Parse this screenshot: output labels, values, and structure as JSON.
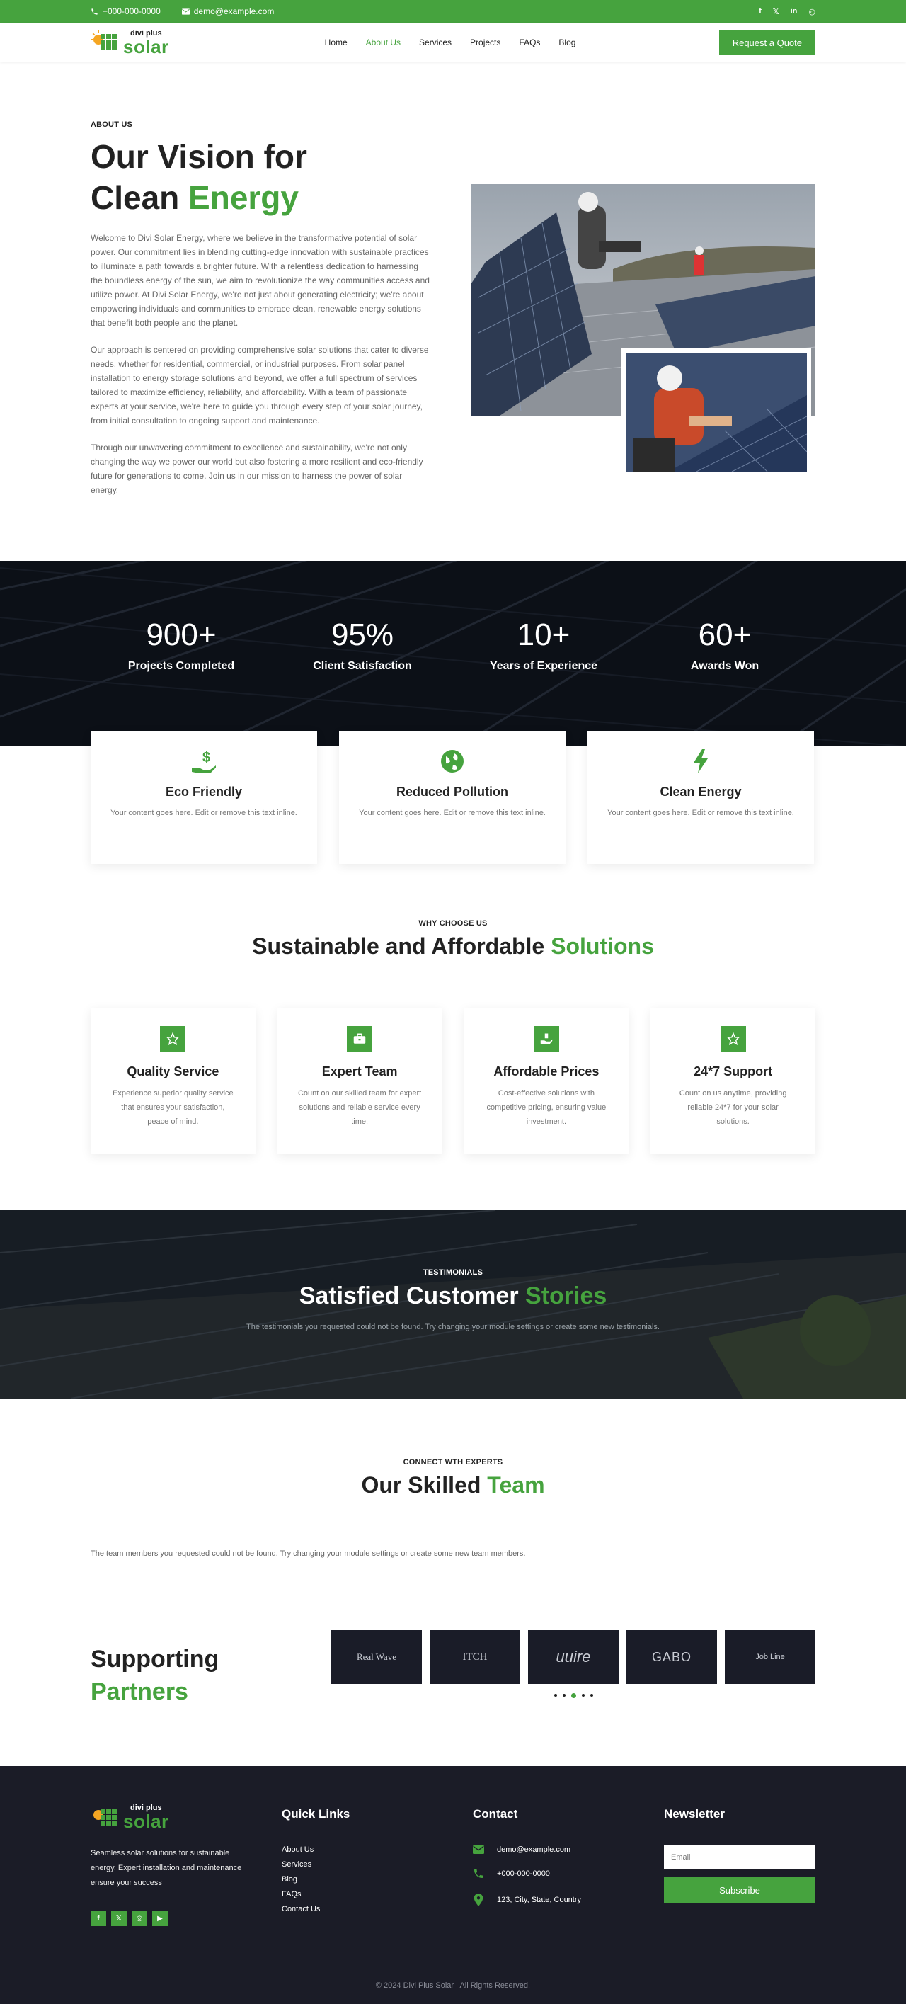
{
  "topbar": {
    "phone": "+000-000-0000",
    "email": "demo@example.com",
    "social": [
      "f",
      "𝕏",
      "in",
      "◎"
    ]
  },
  "header": {
    "logo_small": "divi plus",
    "logo_big": "solar",
    "nav": [
      {
        "label": "Home",
        "active": false
      },
      {
        "label": "About Us",
        "active": true
      },
      {
        "label": "Services",
        "active": false
      },
      {
        "label": "Projects",
        "active": false
      },
      {
        "label": "FAQs",
        "active": false
      },
      {
        "label": "Blog",
        "active": false
      }
    ],
    "cta": "Request a Quote"
  },
  "about": {
    "eyebrow": "ABOUT US",
    "title_line1": "Our Vision for",
    "title_line2_plain": "Clean ",
    "title_line2_accent": "Energy",
    "p1": "Welcome to Divi Solar Energy, where we believe in the transformative potential of solar power. Our commitment lies in blending cutting-edge innovation with sustainable practices to illuminate a path towards a brighter future. With a relentless dedication to harnessing the boundless energy of the sun, we aim to revolutionize the way communities access and utilize power. At Divi Solar Energy, we're not just about generating electricity; we're about empowering individuals and communities to embrace clean, renewable energy solutions that benefit both people and the planet.",
    "p2": "Our approach is centered on providing comprehensive solar solutions that cater to diverse needs, whether for residential, commercial, or industrial purposes. From solar panel installation to energy storage solutions and beyond, we offer a full spectrum of services tailored to maximize efficiency, reliability, and affordability. With a team of passionate experts at your service, we're here to guide you through every step of your solar journey, from initial consultation to ongoing support and maintenance.",
    "p3": "Through our unwavering commitment to excellence and sustainability, we're not only changing the way we power our world but also fostering a more resilient and eco-friendly future for generations to come. Join us in our mission to harness the power of solar energy."
  },
  "stats": [
    {
      "num": "900+",
      "label": "Projects Completed"
    },
    {
      "num": "95%",
      "label": "Client Satisfaction"
    },
    {
      "num": "10+",
      "label": "Years of Experience"
    },
    {
      "num": "60+",
      "label": "Awards Won"
    }
  ],
  "features": [
    {
      "icon": "hand-dollar-icon",
      "title": "Eco Friendly",
      "text": "Your content goes here. Edit or remove this text inline."
    },
    {
      "icon": "globe-icon",
      "title": "Reduced Pollution",
      "text": "Your content goes here. Edit or remove this text inline."
    },
    {
      "icon": "bolt-icon",
      "title": "Clean Energy",
      "text": "Your content goes here. Edit or remove this text inline."
    }
  ],
  "why": {
    "eyebrow": "WHY CHOOSE US",
    "title_plain": "Sustainable and Affordable ",
    "title_accent": "Solutions",
    "cards": [
      {
        "icon": "star-icon",
        "title": "Quality Service",
        "text": "Experience superior quality service that ensures your satisfaction, peace of mind."
      },
      {
        "icon": "briefcase-icon",
        "title": "Expert Team",
        "text": "Count on our skilled team for expert solutions and reliable service every time."
      },
      {
        "icon": "hand-money-icon",
        "title": "Affordable Prices",
        "text": "Cost-effective solutions with competitive pricing, ensuring value investment."
      },
      {
        "icon": "star-icon",
        "title": "24*7 Support",
        "text": "Count on us anytime, providing reliable 24*7 for your solar solutions."
      }
    ]
  },
  "testimonials": {
    "eyebrow": "TESTIMONIALS",
    "title_plain": "Satisfied Customer ",
    "title_accent": "Stories",
    "empty": "The testimonials you requested could not be found. Try changing your module settings or create some new testimonials."
  },
  "team": {
    "eyebrow": "CONNECT WTH EXPERTS",
    "title_plain": "Our Skilled ",
    "title_accent": "Team",
    "empty": "The team members you requested could not be found. Try changing your module settings or create some new team members."
  },
  "partners": {
    "title_plain": "Supporting",
    "title_accent": "Partners",
    "logos": [
      "Real Wave",
      "ITCH",
      "uuire",
      "GABO",
      "Job Line"
    ],
    "active_dot": 2
  },
  "footer": {
    "logo_small": "divi plus",
    "logo_big": "solar",
    "desc": "Seamless solar solutions for sustainable energy. Expert installation and maintenance ensure your success",
    "social": [
      "f",
      "𝕏",
      "◎",
      "▶"
    ],
    "quick_title": "Quick Links",
    "quick_links": [
      "About Us",
      "Services",
      "Blog",
      "FAQs",
      "Contact Us"
    ],
    "contact_title": "Contact",
    "contact": [
      {
        "icon": "envelope-icon",
        "text": "demo@example.com"
      },
      {
        "icon": "phone-icon",
        "text": "+000-000-0000"
      },
      {
        "icon": "map-pin-icon",
        "text": "123, City, State, Country"
      }
    ],
    "newsletter_title": "Newsletter",
    "email_placeholder": "Email",
    "subscribe": "Subscribe",
    "copyright": "© 2024 Divi Plus Solar | All Rights Reserved."
  },
  "colors": {
    "accent": "#46a33e",
    "dark": "#1b1c27"
  }
}
